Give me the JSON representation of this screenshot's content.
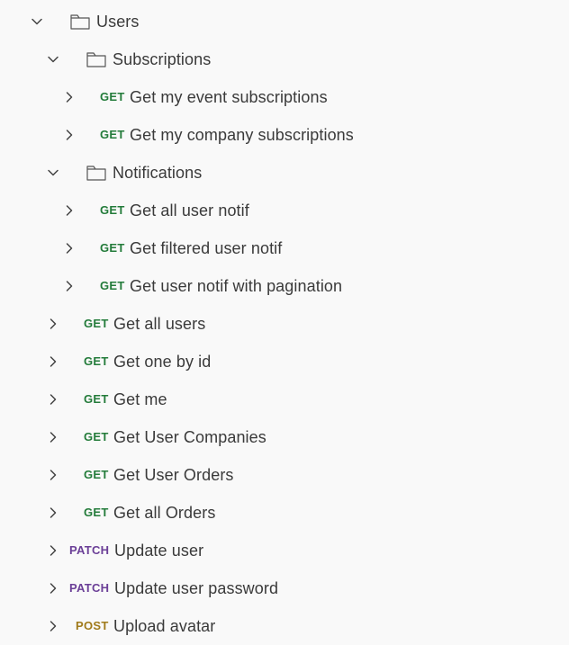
{
  "tree": {
    "folders": {
      "users": {
        "label": "Users",
        "expanded": true
      },
      "subscriptions": {
        "label": "Subscriptions",
        "expanded": true
      },
      "notifications": {
        "label": "Notifications",
        "expanded": true
      }
    },
    "requests": [
      {
        "method": "GET",
        "label": "Get my event subscriptions"
      },
      {
        "method": "GET",
        "label": "Get my company subscriptions"
      },
      {
        "method": "GET",
        "label": "Get all user notif"
      },
      {
        "method": "GET",
        "label": "Get filtered user notif"
      },
      {
        "method": "GET",
        "label": "Get user notif with pagination"
      },
      {
        "method": "GET",
        "label": "Get all users"
      },
      {
        "method": "GET",
        "label": "Get one by id"
      },
      {
        "method": "GET",
        "label": "Get me"
      },
      {
        "method": "GET",
        "label": "Get User Companies"
      },
      {
        "method": "GET",
        "label": "Get User Orders"
      },
      {
        "method": "GET",
        "label": "Get all Orders"
      },
      {
        "method": "PATCH",
        "label": "Update user"
      },
      {
        "method": "PATCH",
        "label": "Update user password"
      },
      {
        "method": "POST",
        "label": "Upload avatar"
      }
    ]
  },
  "colors": {
    "get": "#237b3a",
    "patch": "#6b3f97",
    "post": "#a07a1a",
    "text": "#3a3a3a",
    "background": "#f9f9f9"
  }
}
